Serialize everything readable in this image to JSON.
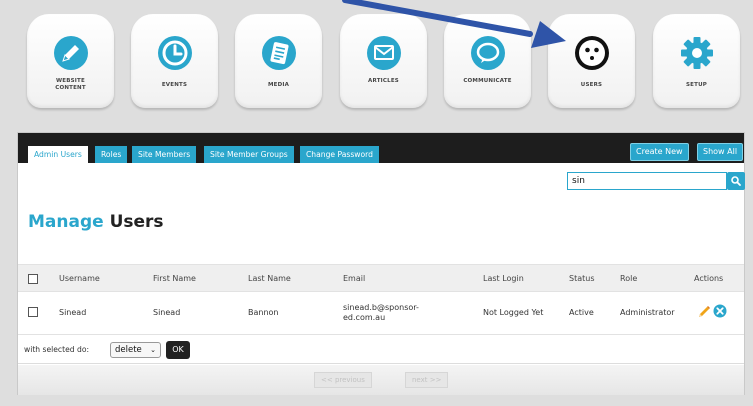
{
  "modules": [
    {
      "id": "website-content",
      "line1": "WEBSITE",
      "line2": "CONTENT",
      "icon": "pencil-icon"
    },
    {
      "id": "events",
      "line1": "EVENTS",
      "line2": "",
      "icon": "clock-icon"
    },
    {
      "id": "media",
      "line1": "MEDIA",
      "line2": "",
      "icon": "document-icon"
    },
    {
      "id": "articles",
      "line1": "ARTICLES",
      "line2": "",
      "icon": "envelope-icon"
    },
    {
      "id": "communicate",
      "line1": "COMMUNICATE",
      "line2": "",
      "icon": "speech-bubble-icon"
    },
    {
      "id": "users",
      "line1": "USERS",
      "line2": "",
      "icon": "face-icon"
    },
    {
      "id": "setup",
      "line1": "SETUP",
      "line2": "",
      "icon": "gear-icon"
    }
  ],
  "colors": {
    "accent": "#2aa6cc",
    "dark": "#1d1d1d",
    "pointer": "#2f54a8"
  },
  "tabs": [
    "Admin Users",
    "Roles",
    "Site Members",
    "Site Member Groups",
    "Change Password"
  ],
  "actions": {
    "create_new": "Create New",
    "show_all": "Show All"
  },
  "search": {
    "value": "sin"
  },
  "title": {
    "part1": "Manage",
    "part2": "Users"
  },
  "table": {
    "columns": [
      "Username",
      "First Name",
      "Last Name",
      "Email",
      "Last Login",
      "Status",
      "Role",
      "Actions"
    ],
    "rows": [
      {
        "username": "Sinead",
        "first_name": "Sinead",
        "last_name": "Bannon",
        "email_line1": "sinead.b@sponsor-",
        "email_line2": "ed.com.au",
        "last_login": "Not Logged Yet",
        "status": "Active",
        "role": "Administrator"
      }
    ]
  },
  "bulk": {
    "label": "with selected do:",
    "selected": "delete",
    "ok": "OK"
  },
  "pager": {
    "previous": "<< previous",
    "next": "next >>"
  }
}
